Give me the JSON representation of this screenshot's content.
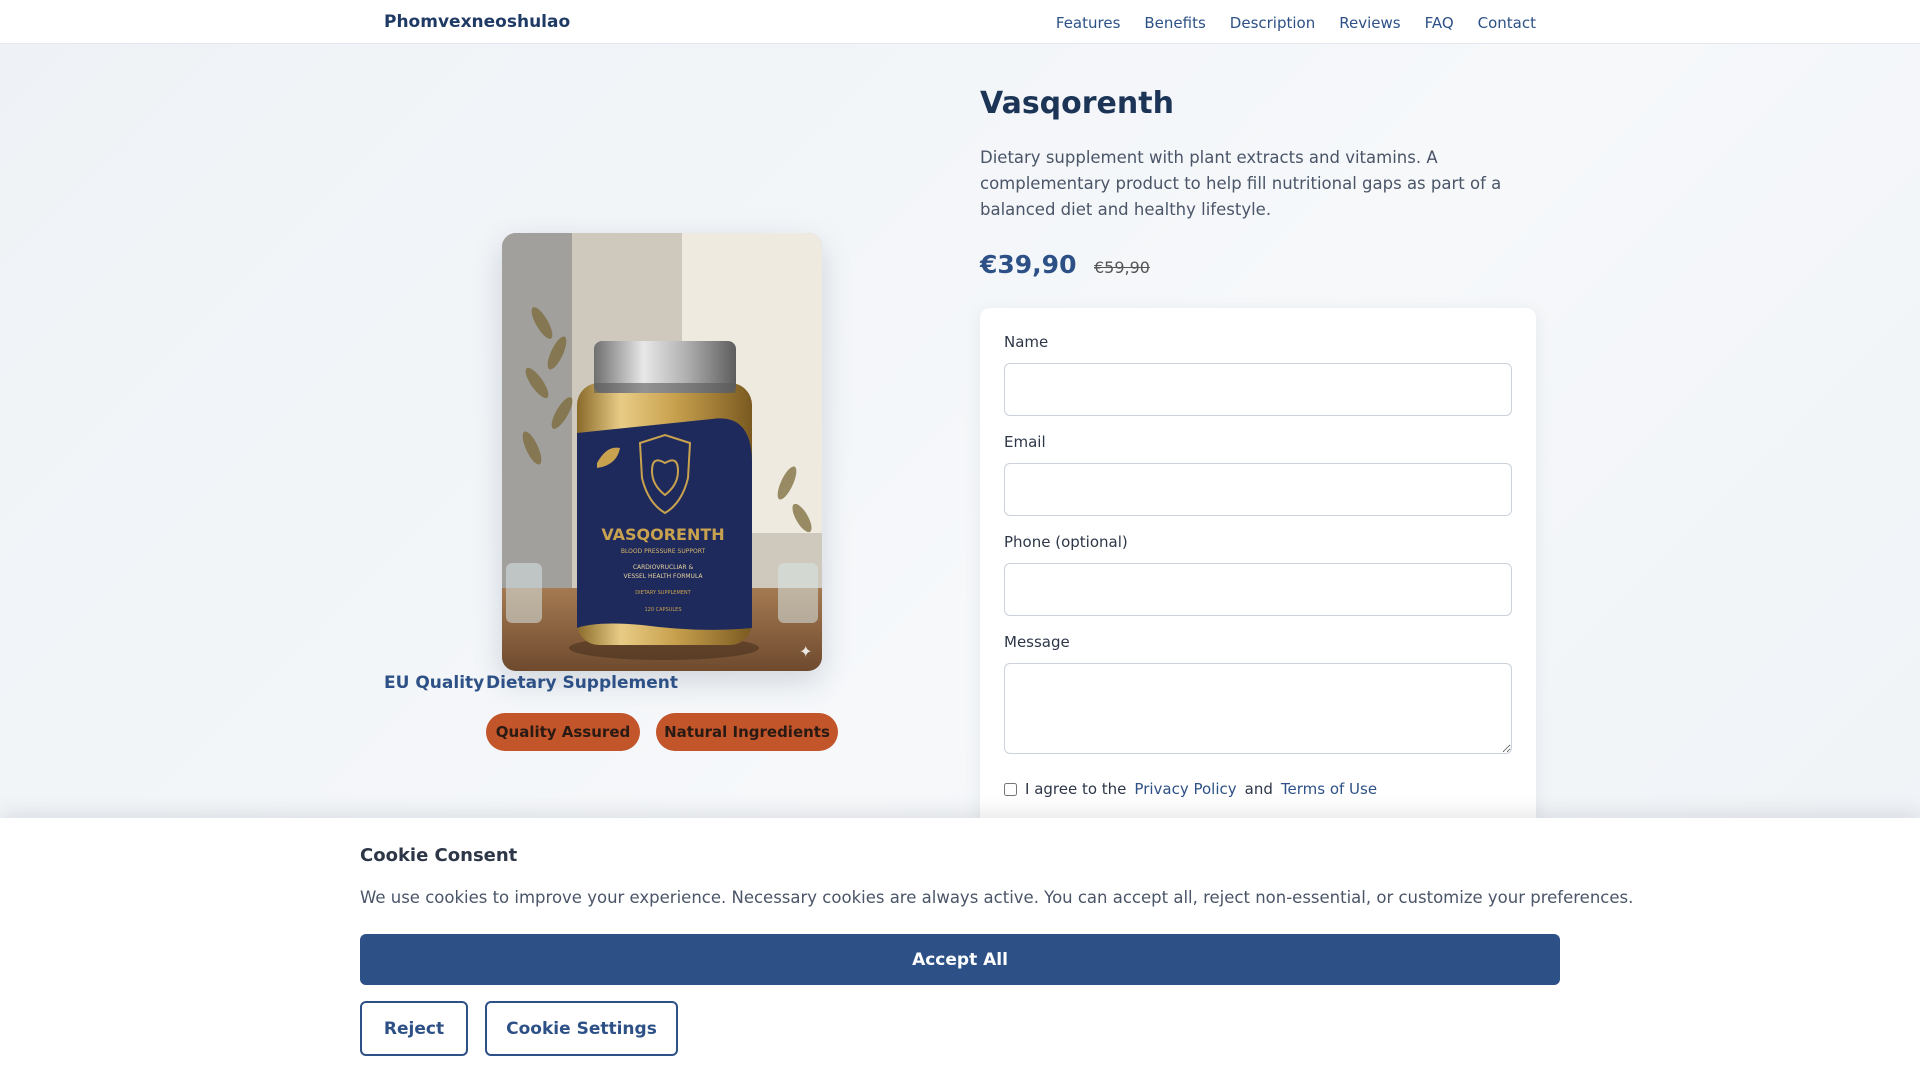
{
  "nav": {
    "brand": "Phomvexneoshulao",
    "links": [
      "Features",
      "Benefits",
      "Description",
      "Reviews",
      "FAQ",
      "Contact"
    ]
  },
  "product": {
    "image": {
      "brand_on_label": "VASQORENTH",
      "label_subtitle": "BLOOD PRESSURE SUPPORT",
      "label_line_1": "CARDIOVRUCLIAR &",
      "label_line_2": "VESSEL HEALTH FORMULA",
      "label_type": "DIETARY SUPPLEMENT",
      "label_count": "120 CAPSULES"
    },
    "badges": [
      "EU Quality",
      "Dietary Supplement"
    ],
    "pills": [
      "Quality Assured",
      "Natural Ingredients"
    ],
    "title": "Vasqorenth",
    "description": "Dietary supplement with plant extracts and vitamins. A complementary product to help fill nutritional gaps as part of a balanced diet and healthy lifestyle.",
    "price": "€39,90",
    "old_price": "€59,90"
  },
  "form": {
    "name_label": "Name",
    "email_label": "Email",
    "phone_label": "Phone (optional)",
    "message_label": "Message",
    "agree_prefix": "I agree to the",
    "privacy_link": "Privacy Policy",
    "agree_and": "and",
    "terms_link": "Terms of Use"
  },
  "cookie": {
    "title": "Cookie Consent",
    "text": "We use cookies to improve your experience. Necessary cookies are always active. You can accept all, reject non-essential, or customize your preferences.",
    "accept_label": "Accept All",
    "reject_label": "Reject",
    "settings_label": "Cookie Settings"
  },
  "colors": {
    "accent": "#2d5186",
    "pill": "#c2552a",
    "heading": "#1c3557"
  }
}
